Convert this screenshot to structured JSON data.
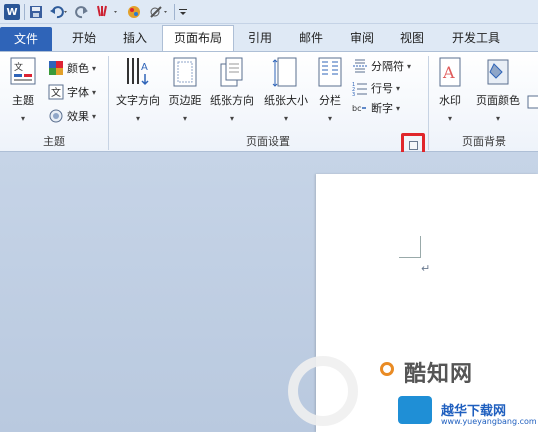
{
  "qat": {
    "app_icon": "W",
    "icons": [
      "save-icon",
      "undo-icon",
      "redo-icon",
      "format-painter-icon",
      "color-icon",
      "draw-icon",
      "customize-icon"
    ]
  },
  "tabs": {
    "file": "文件",
    "home": "开始",
    "insert": "插入",
    "page_layout": "页面布局",
    "references": "引用",
    "mailings": "邮件",
    "review": "审阅",
    "view": "视图",
    "developer": "开发工具"
  },
  "groups": {
    "theme": {
      "label": "主题",
      "theme_button": "主题",
      "colors": "颜色",
      "fonts": "字体",
      "effects": "效果"
    },
    "page_setup": {
      "label": "页面设置",
      "text_direction": "文字方向",
      "margins": "页边距",
      "orientation": "纸张方向",
      "size": "纸张大小",
      "columns": "分栏",
      "breaks": "分隔符",
      "line_numbers": "行号",
      "hyphenation": "断字"
    },
    "page_background": {
      "label": "页面背景",
      "watermark": "水印",
      "page_color": "页面颜色"
    }
  },
  "watermark": {
    "brand1": "酷知网",
    "brand2": "越华下载网",
    "url": "www.yueyangbang.com"
  },
  "colors": {
    "file_tab": "#2f64b8",
    "highlight": "#e0262b"
  }
}
